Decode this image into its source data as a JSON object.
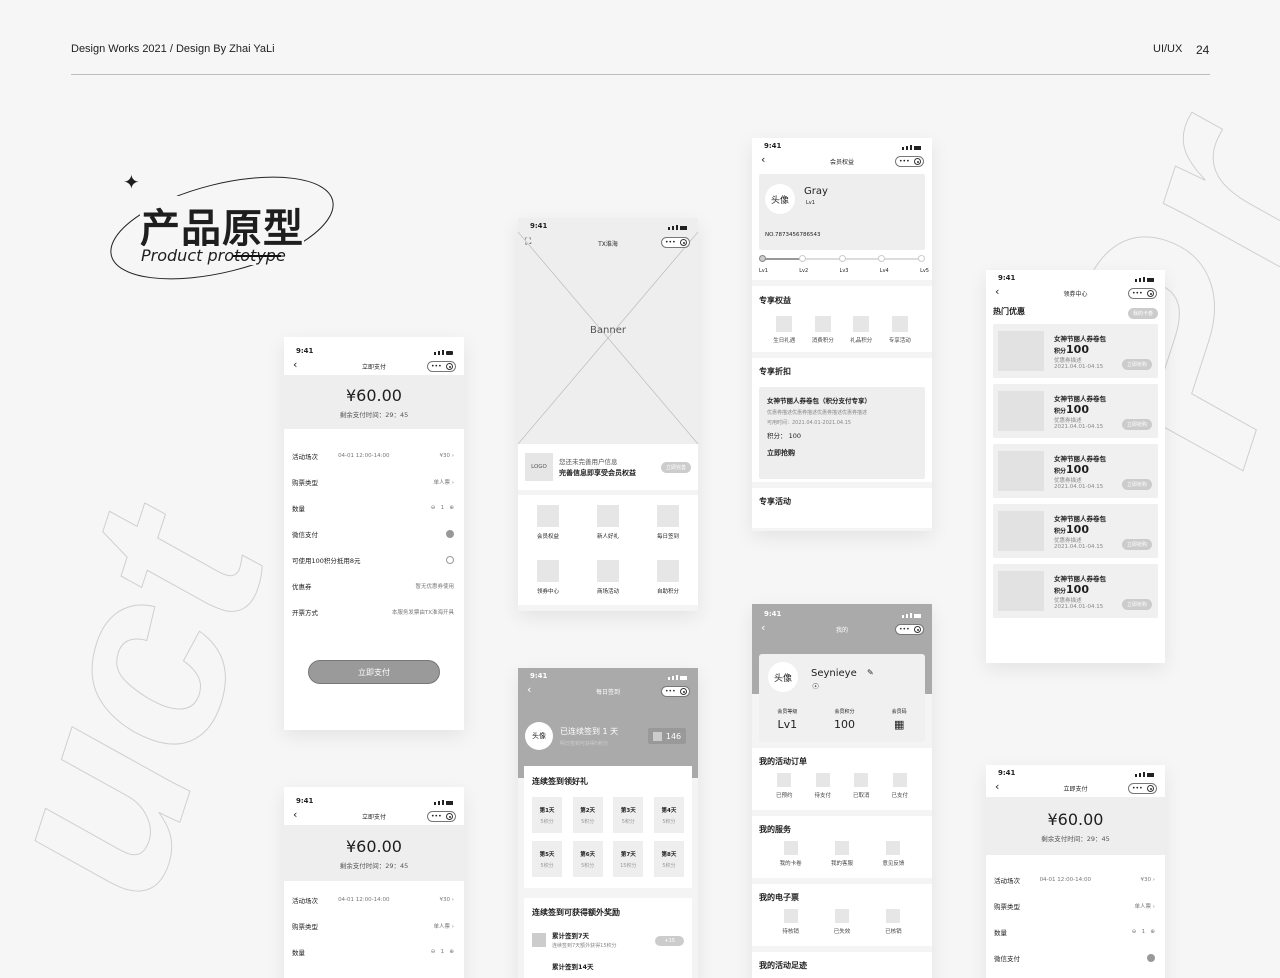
{
  "header": {
    "left": "Design Works 2021 / Design By Zhai YaLi",
    "tag": "UI/UX",
    "page": "24"
  },
  "title": {
    "cn": "产品原型",
    "en": "Product prototype"
  },
  "bg_words": {
    "right": "Pr",
    "left": "uct"
  },
  "status": {
    "time": "9:41"
  },
  "pay": {
    "nav": "立即支付",
    "amount": "¥60.00",
    "remain": "剩余支付时间：29：45",
    "rows": [
      {
        "label": "活动场次",
        "date": "04-01  12:00-14:00",
        "value": "¥30"
      },
      {
        "label": "购票类型",
        "value": "单人票"
      },
      {
        "label": "数量",
        "qty": "1"
      },
      {
        "label": "微信支付"
      },
      {
        "label": "可使用100积分抵用8元"
      },
      {
        "label": "优惠券",
        "value": "暂无优惠券使用"
      },
      {
        "label": "开票方式",
        "value": "本服务发票由TX淮海开具"
      }
    ],
    "button": "立即支付"
  },
  "home": {
    "nav": "TX淮海",
    "banner": "Banner",
    "logo": "LOGO",
    "msg1": "您还未完善用户信息",
    "msg2": "完善信息即享受会员权益",
    "complete": "立即完善",
    "grid": [
      "会员权益",
      "新人好礼",
      "每日签到",
      "领券中心",
      "商场活动",
      "自助积分"
    ]
  },
  "vip": {
    "nav": "会员权益",
    "avatar": "头像",
    "name": "Gray",
    "lvl": "Lv1",
    "no": "NO.7873456786543",
    "levels": [
      "Lv1",
      "Lv2",
      "Lv3",
      "Lv4",
      "Lv5"
    ],
    "s1": "专享权益",
    "rights": [
      "生日礼遇",
      "消费积分",
      "礼品积分",
      "专享活动"
    ],
    "s2": "专享折扣",
    "card_title": "女神节丽人券卷包（积分支付专享）",
    "card_desc": "优惠券描述优惠券描述优惠券描述优惠券描述",
    "card_date": "可用时间：2021.04.01-2021.04.15",
    "card_pts": "积分： 100",
    "card_btn": "立即抢购",
    "s3": "专享活动"
  },
  "coupon": {
    "nav": "领券中心",
    "section": "热门优惠",
    "mine": "我的卡卷",
    "item": {
      "title": "女神节丽人券卷包",
      "pts_label": "积分",
      "pts": "100",
      "desc": "优惠券描述",
      "date": "2021.04.01-04.15",
      "btn": "立即抢购"
    }
  },
  "checkin": {
    "nav": "每日签到",
    "avatar": "头像",
    "days": "已连续签到 1 天",
    "sub": "明日签到可获得5积分",
    "points": "146",
    "s1": "连续签到领好礼",
    "grid": [
      {
        "d": "第1天",
        "p": "5积分"
      },
      {
        "d": "第2天",
        "p": "5积分"
      },
      {
        "d": "第3天",
        "p": "5积分"
      },
      {
        "d": "第4天",
        "p": "5积分"
      },
      {
        "d": "第5天",
        "p": "5积分"
      },
      {
        "d": "第6天",
        "p": "5积分"
      },
      {
        "d": "第7天",
        "p": "15积分"
      },
      {
        "d": "第8天",
        "p": "5积分"
      }
    ],
    "s2": "连续签到可获得额外奖励",
    "reward_title": "累计签到7天",
    "reward_desc": "连续签到7天额外获得15积分",
    "reward_badge": "+15",
    "reward2": "累计签到14天"
  },
  "mine": {
    "nav": "我的",
    "avatar": "头像",
    "name": "Seynieye",
    "stats": [
      {
        "k": "会员等级",
        "v": "Lv1"
      },
      {
        "k": "会员积分",
        "v": "100"
      },
      {
        "k": "会员码",
        "v": ""
      }
    ],
    "s1": "我的活动订单",
    "orders": [
      "已预约",
      "待支付",
      "已取消",
      "已支付"
    ],
    "s2": "我的服务",
    "services": [
      "我的卡卷",
      "我的客服",
      "意见反馈"
    ],
    "s3": "我的电子票",
    "tickets": [
      "待核销",
      "已失效",
      "已核销"
    ],
    "s4": "我的活动足迹"
  }
}
